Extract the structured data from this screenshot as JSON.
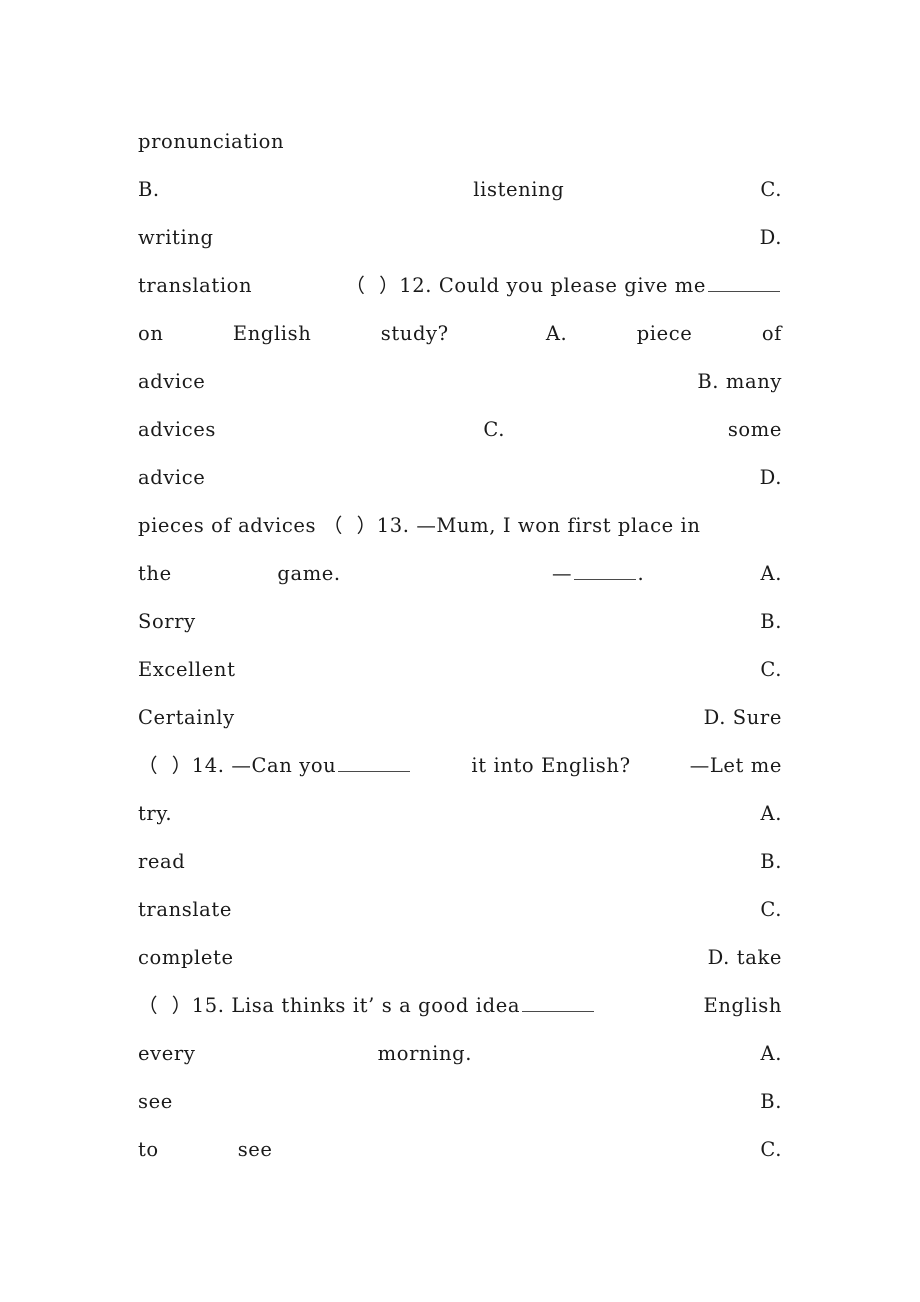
{
  "document": {
    "type": "english-exam-multiple-choice",
    "page_background": "#ffffff",
    "text_color": "#1a1a1a",
    "lines": [
      {
        "id": "line-1",
        "align": "flush",
        "text": "pronunciation",
        "segments": [
          "pronunciation"
        ]
      },
      {
        "id": "line-2",
        "align": "justify",
        "text": "B.            listening                              C.",
        "segments": [
          "B.",
          "listening",
          "C."
        ]
      },
      {
        "id": "line-3",
        "align": "justify",
        "text": "writing                                              D.",
        "segments": [
          "writing",
          "D."
        ]
      },
      {
        "id": "line-4",
        "align": "justify",
        "text": "translation （ ）12. Could you please give me ______",
        "segments": [
          "translation",
          "（  ）12. Could you please give me"
        ],
        "trailing_blank": true
      },
      {
        "id": "line-5",
        "align": "justify",
        "text": "on    English    study?        A.      piece     of",
        "segments": [
          "on",
          "English",
          "study?",
          "A.",
          "piece",
          "of"
        ]
      },
      {
        "id": "line-6",
        "align": "justify",
        "text": "advice                                       B.  many",
        "segments": [
          "advice",
          "B. many"
        ]
      },
      {
        "id": "line-7",
        "align": "justify",
        "text": "advices                     C.                   some",
        "segments": [
          "advices",
          "C.",
          "some"
        ]
      },
      {
        "id": "line-8",
        "align": "justify",
        "text": "advice                                             D.",
        "segments": [
          "advice",
          "D."
        ]
      },
      {
        "id": "line-9",
        "align": "justify",
        "text": "pieces of advices （ ）13. —Mum, I won first place in",
        "segments": [
          "pieces of advices （  ）13. —Mum, I won first place in"
        ]
      },
      {
        "id": "line-10",
        "align": "justify",
        "text": "the      game.              —______.            A.",
        "segments": [
          "the",
          "game.",
          "—",
          "BLANK",
          ".",
          "A."
        ]
      },
      {
        "id": "line-11",
        "align": "justify",
        "text": "Sorry                                              B.",
        "segments": [
          "Sorry",
          "B."
        ]
      },
      {
        "id": "line-12",
        "align": "justify",
        "text": "Excellent                                          C.",
        "segments": [
          "Excellent",
          "C."
        ]
      },
      {
        "id": "line-13",
        "align": "justify",
        "text": "Certainly                                    D. Sure",
        "segments": [
          "Certainly",
          "D. Sure"
        ]
      },
      {
        "id": "line-14",
        "align": "justify",
        "text": "（ ）14. —Can you ______ it into English?  —Let me",
        "segments": [
          "（  ）14. —Can you",
          "BLANK",
          "it into English?",
          "—Let me"
        ]
      },
      {
        "id": "line-15",
        "align": "justify",
        "text": "try.                                               A.",
        "segments": [
          "try.",
          "A."
        ]
      },
      {
        "id": "line-16",
        "align": "justify",
        "text": "read                                               B.",
        "segments": [
          "read",
          "B."
        ]
      },
      {
        "id": "line-17",
        "align": "justify",
        "text": "translate                                          C.",
        "segments": [
          "translate",
          "C."
        ]
      },
      {
        "id": "line-18",
        "align": "justify",
        "text": "complete                                     D. take",
        "segments": [
          "complete",
          "D. take"
        ]
      },
      {
        "id": "line-19",
        "align": "justify",
        "text": "（ ）15. Lisa thinks it’ s a good idea ______ English",
        "segments": [
          "（  ）15. Lisa thinks it’ s a good idea",
          "BLANK",
          "English"
        ]
      },
      {
        "id": "line-20",
        "align": "justify",
        "text": "every              morning.                        A.",
        "segments": [
          "every",
          "morning.",
          "A."
        ]
      },
      {
        "id": "line-21",
        "align": "justify",
        "text": "see                                                B.",
        "segments": [
          "see",
          "B."
        ]
      },
      {
        "id": "line-22",
        "align": "justify",
        "text": "to          see                                    C.",
        "segments": [
          "to",
          "see",
          "C."
        ]
      }
    ],
    "questions": [
      {
        "number": "12",
        "stem": "Could you please give me ______ on English study?",
        "options": [
          {
            "letter": "A.",
            "text": "piece of advice"
          },
          {
            "letter": "B.",
            "text": "many advices"
          },
          {
            "letter": "C.",
            "text": "some advice"
          },
          {
            "letter": "D.",
            "text": "pieces of advices"
          }
        ]
      },
      {
        "number": "13",
        "stem": "—Mum, I won first place in the game. —______.",
        "options": [
          {
            "letter": "A.",
            "text": "Sorry"
          },
          {
            "letter": "B.",
            "text": "Excellent"
          },
          {
            "letter": "C.",
            "text": "Certainly"
          },
          {
            "letter": "D.",
            "text": "Sure"
          }
        ]
      },
      {
        "number": "14",
        "stem": "—Can you ______ it into English? —Let me try.",
        "options": [
          {
            "letter": "A.",
            "text": "read"
          },
          {
            "letter": "B.",
            "text": "translate"
          },
          {
            "letter": "C.",
            "text": "complete"
          },
          {
            "letter": "D.",
            "text": "take"
          }
        ]
      },
      {
        "number": "15",
        "stem": "Lisa thinks it’s a good idea ______ English every morning.",
        "options": [
          {
            "letter": "A.",
            "text": "see"
          },
          {
            "letter": "B.",
            "text": "to see"
          },
          {
            "letter": "C.",
            "text": ""
          }
        ]
      }
    ],
    "partial_options_top": [
      {
        "letter": "",
        "text": "pronunciation"
      },
      {
        "letter": "B.",
        "text": "listening"
      },
      {
        "letter": "C.",
        "text": "writing"
      },
      {
        "letter": "D.",
        "text": "translation"
      }
    ]
  }
}
